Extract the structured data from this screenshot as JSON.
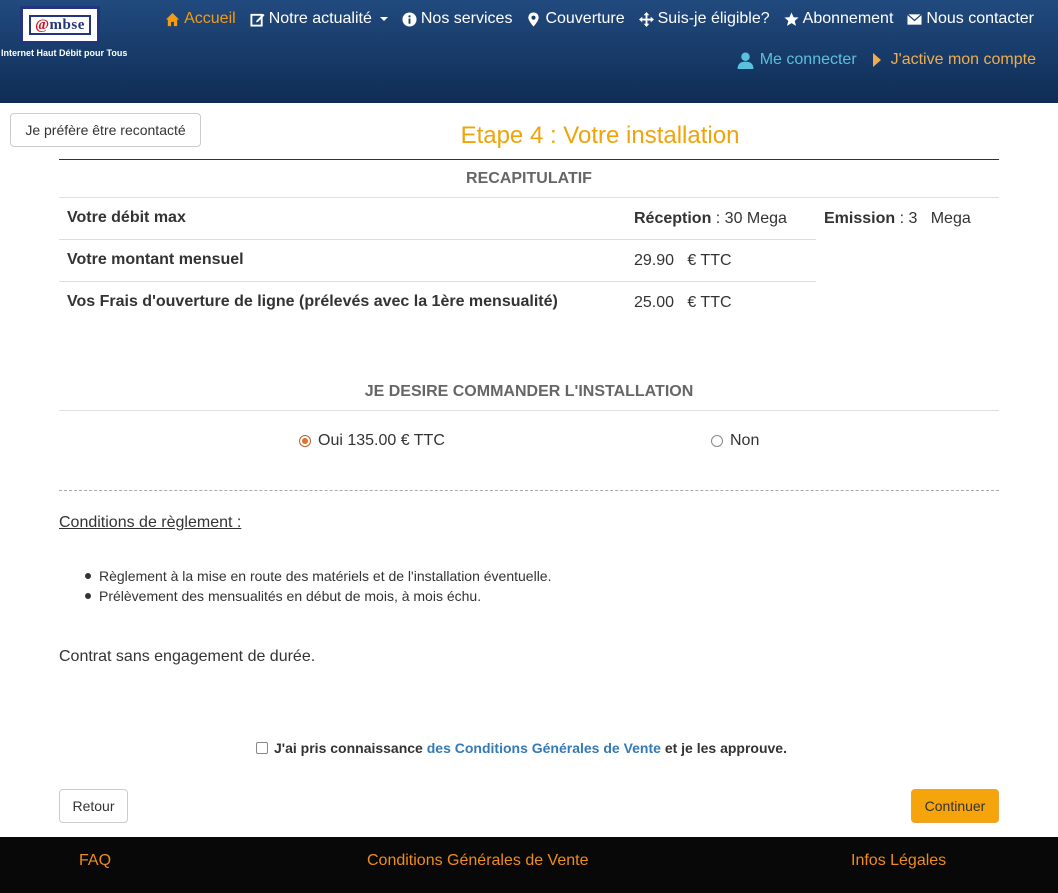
{
  "header": {
    "logo_text_prefix": "@",
    "logo_text_suffix": "mbse",
    "tagline": "Internet Haut Débit pour Tous",
    "nav": [
      {
        "label": "Accueil",
        "icon": "home-icon"
      },
      {
        "label": "Notre actualité",
        "icon": "edit-icon"
      },
      {
        "label": "Nos services",
        "icon": "info-icon"
      },
      {
        "label": "Couverture",
        "icon": "map-marker-icon"
      },
      {
        "label": "Suis-je éligible?",
        "icon": "move-icon"
      },
      {
        "label": "Abonnement",
        "icon": "star-icon"
      },
      {
        "label": "Nous contacter",
        "icon": "envelope-icon"
      }
    ],
    "login_label": "Me connecter",
    "activate_label": "J'active mon compte"
  },
  "recontact_label": "Je préfère être recontacté",
  "step_title": "Etape 4 : Votre installation",
  "recap": {
    "heading": "RECAPITULATIF",
    "debit_label": "Votre débit max",
    "reception_label": "Réception",
    "reception_value": " : 30 Mega",
    "emission_label": "Emission",
    "emission_value": " : 3   Mega",
    "monthly_label": "Votre montant mensuel",
    "monthly_value": "29.90   € TTC",
    "fees_label": "Vos Frais d'ouverture de ligne (prélevés avec la 1ère mensualité)",
    "fees_value": "25.00   € TTC"
  },
  "install": {
    "heading": "JE DESIRE COMMANDER L'INSTALLATION",
    "yes_label": "Oui 135.00 € TTC",
    "no_label": "Non",
    "selected": "yes"
  },
  "conditions": {
    "title": "Conditions de règlement :",
    "items": [
      "Règlement à la mise en route des matériels et de l'installation éventuelle.",
      "Prélèvement des mensualités en début de mois, à mois échu."
    ],
    "contract": "Contrat sans engagement de durée."
  },
  "cgv": {
    "before": "J'ai pris connaissance ",
    "link": "des Conditions Générales de Vente",
    "after": " et je les approuve."
  },
  "buttons": {
    "back": "Retour",
    "continue": "Continuer"
  },
  "footer": {
    "faq": "FAQ",
    "cgv": "Conditions Générales de Vente",
    "legal": "Infos Légales"
  },
  "colors": {
    "accent_orange": "#f0a30a",
    "header_blue": "#173a68",
    "link_blue": "#337ab7",
    "login_cyan": "#5bc0de"
  }
}
